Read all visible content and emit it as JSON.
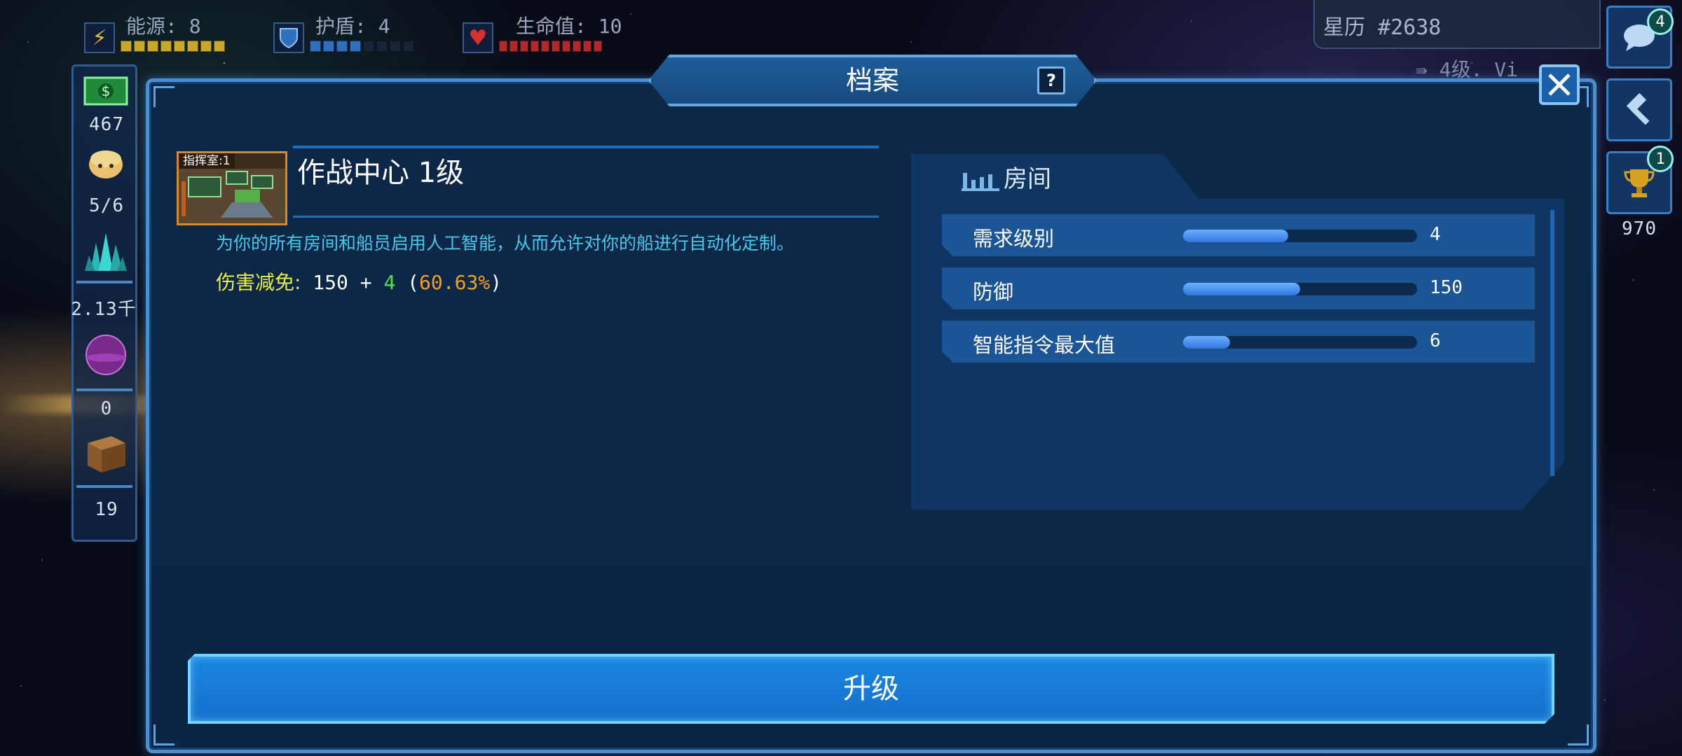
{
  "top_stats": {
    "energy": {
      "label": "能源: 8",
      "icon": "lightning-icon",
      "color": "#c8a82a",
      "filled": 8,
      "total": 8
    },
    "shield": {
      "label": "护盾: 4",
      "icon": "shield-icon",
      "color": "#2f6fc0",
      "filled": 4,
      "total": 8
    },
    "health": {
      "label": "生命值: 10",
      "icon": "heart-icon",
      "color": "#b02a2a",
      "filled": 10,
      "total": 10
    }
  },
  "stardate": "星历 #2638",
  "rank_text": "4级. Vi",
  "resources": {
    "money": "467",
    "crew": "5/6",
    "minerals": "2.13千",
    "gas": "0",
    "supplies": "19"
  },
  "right_buttons": {
    "chat_badge": "4",
    "trophy_badge": "1",
    "trophy_count": "970"
  },
  "panel": {
    "title": "档案",
    "help_label": "?"
  },
  "room": {
    "tag": "指挥室:1",
    "name": "作战中心 1级",
    "description": "为你的所有房间和船员启用人工智能，从而允许对你的船进行自动化定制。",
    "damage_label": "伤害减免:",
    "damage_base": "150",
    "damage_plus": "+",
    "damage_bonus": "4",
    "damage_open": "(",
    "damage_percent": "60.63%",
    "damage_close": ")"
  },
  "stats": {
    "header": "房间",
    "rows": [
      {
        "name": "需求级别",
        "value": "4",
        "fill": 0.45
      },
      {
        "name": "防御",
        "value": "150",
        "fill": 0.5
      },
      {
        "name": "智能指令最大值",
        "value": "6",
        "fill": 0.2
      }
    ]
  },
  "upgrade_label": "升级",
  "colors": {
    "accent": "#4a90d0",
    "panel_bg": "#0c2646",
    "upgrade": "#1a86e0",
    "description": "#45c9e8",
    "damage_label": "#eaf040"
  }
}
